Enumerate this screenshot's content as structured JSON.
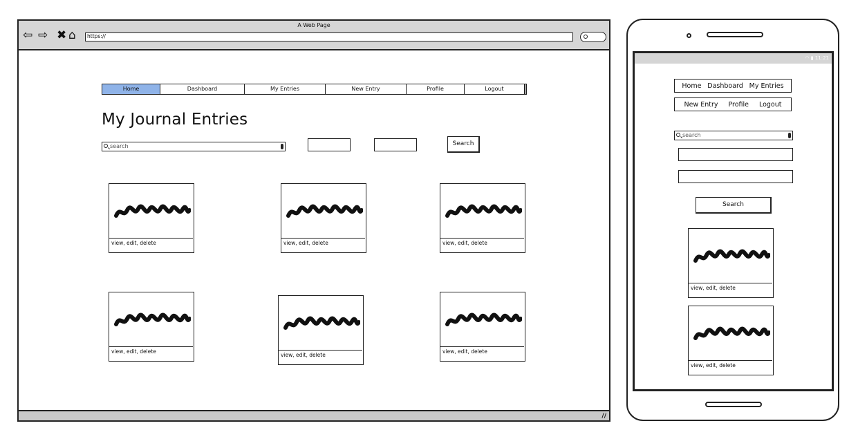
{
  "browser": {
    "title": "A Web Page",
    "url": "https://",
    "icons": [
      "back-arrow-icon",
      "forward-arrow-icon",
      "close-icon",
      "home-icon",
      "search-icon"
    ]
  },
  "nav": {
    "items": [
      {
        "label": "Home",
        "active": true
      },
      {
        "label": "Dashboard",
        "active": false
      },
      {
        "label": "My Entries",
        "active": false
      },
      {
        "label": "New Entry",
        "active": false
      },
      {
        "label": "Profile",
        "active": false
      },
      {
        "label": "Logout",
        "active": false
      }
    ],
    "active_color": "#8fb3e8"
  },
  "page": {
    "title": "My Journal Entries",
    "search_placeholder": "search",
    "search_button": "Search"
  },
  "cards": [
    {
      "caption": "view, edit, delete"
    },
    {
      "caption": "view, edit, delete"
    },
    {
      "caption": "view, edit, delete"
    },
    {
      "caption": "view, edit, delete"
    },
    {
      "caption": "view, edit, delete"
    },
    {
      "caption": "view, edit, delete"
    }
  ],
  "mobile": {
    "status": "11:21",
    "nav_row1": [
      "Home",
      "Dashboard",
      "My Entries"
    ],
    "nav_row2": [
      "New Entry",
      "Profile",
      "Logout"
    ],
    "search_placeholder": "search",
    "search_button": "Search",
    "cards": [
      {
        "caption": "view, edit, delete"
      },
      {
        "caption": "view, edit, delete"
      }
    ]
  }
}
